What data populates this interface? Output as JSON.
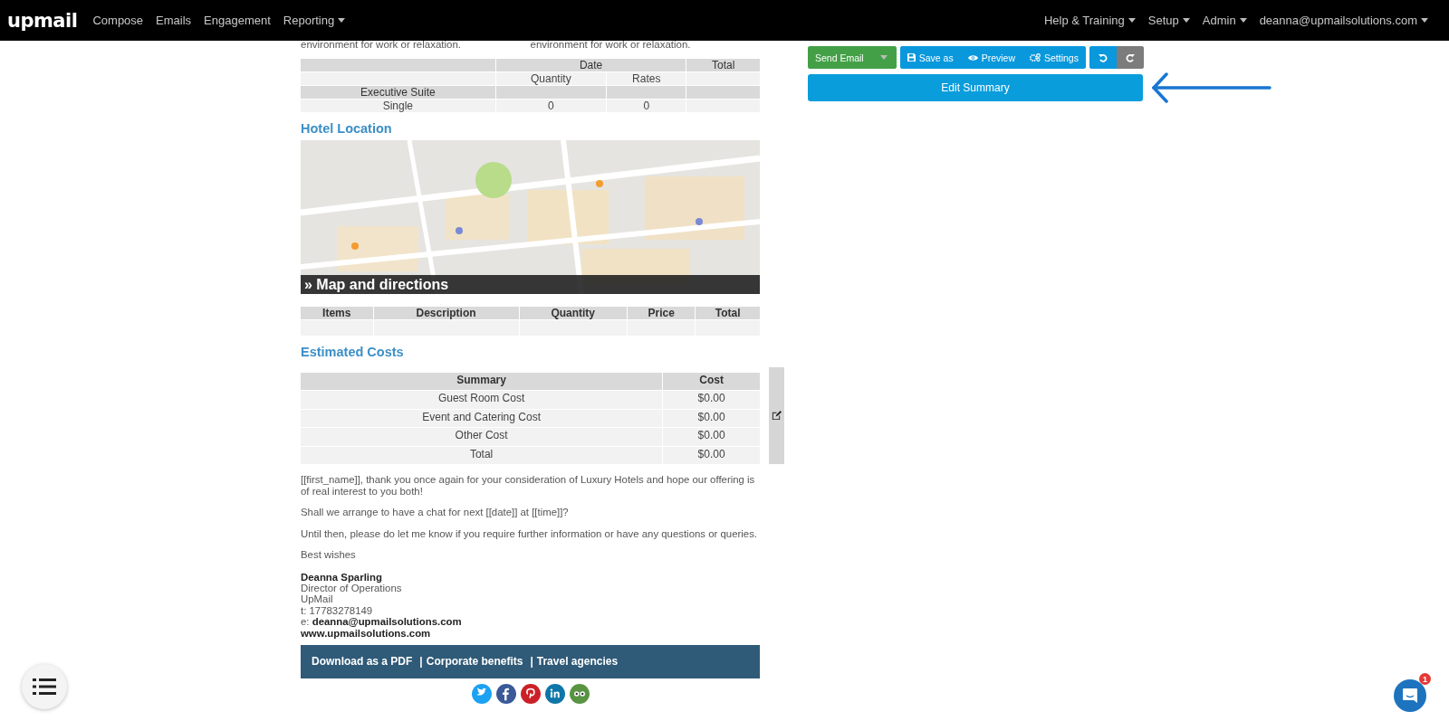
{
  "nav": {
    "logo": "upmail",
    "left": [
      {
        "label": "Compose",
        "dropdown": false
      },
      {
        "label": "Emails",
        "dropdown": false
      },
      {
        "label": "Engagement",
        "dropdown": false
      },
      {
        "label": "Reporting",
        "dropdown": true
      }
    ],
    "right": [
      {
        "label": "Help & Training",
        "dropdown": true
      },
      {
        "label": "Setup",
        "dropdown": true
      },
      {
        "label": "Admin",
        "dropdown": true
      },
      {
        "label": "deanna@upmailsolutions.com",
        "dropdown": true
      }
    ]
  },
  "email": {
    "intro_columns": [
      "environment for work or relaxation.",
      "environment for work or relaxation."
    ],
    "rates_table": {
      "header": {
        "date": "Date",
        "total": "Total"
      },
      "rows": [
        {
          "kind": "subheader",
          "quantity": "Quantity",
          "rates": "Rates"
        },
        {
          "kind": "group",
          "label": "Executive Suite"
        },
        {
          "kind": "item",
          "label": "Single",
          "quantity": "0",
          "rates": "0"
        }
      ]
    },
    "location_heading": "Hotel Location",
    "map": {
      "kind": "picture",
      "caption": "» Map and directions"
    },
    "items_table": {
      "columns": [
        "Items",
        "Description",
        "Quantity",
        "Price",
        "Total"
      ],
      "empty_rows": [
        {
          "kind": "blank"
        }
      ]
    },
    "costs_heading": "Estimated Costs",
    "costs_table": {
      "columns": [
        "Summary",
        "Cost"
      ],
      "rows": [
        [
          "Guest Room Cost",
          "$0.00"
        ],
        [
          "Event and Catering Cost",
          "$0.00"
        ],
        [
          "Other Cost",
          "$0.00"
        ],
        [
          "Total",
          "$0.00"
        ]
      ]
    },
    "paragraphs": [
      "[[first_name]], thank you once again for your consideration of Luxury Hotels and hope our offering is of real interest to you both!",
      "Shall we arrange to have a chat for next [[date]] at [[time]]?",
      "Until then, please do let me know if you require further information or have any questions or queries.",
      "Best wishes"
    ],
    "signature": {
      "name": "Deanna Sparling",
      "lines": [
        "Director of Operations",
        "UpMail",
        "t: 17783278149",
        "e: **deanna@upmailsolutions.com**"
      ],
      "website": "www.upmailsolutions.com"
    },
    "footer": {
      "links": [
        "Download as a PDF",
        "Corporate benefits",
        "Travel agencies"
      ],
      "separator": "|"
    },
    "social": [
      {
        "kind": "twitter"
      },
      {
        "kind": "facebook"
      },
      {
        "kind": "pinterest"
      },
      {
        "kind": "linkedin"
      },
      {
        "kind": "tripadvisor"
      }
    ]
  },
  "toolbar": {
    "send": "Send Email",
    "actions": [
      {
        "kind": "save",
        "label": "Save as"
      },
      {
        "kind": "preview",
        "label": "Preview"
      },
      {
        "kind": "settings",
        "label": "Settings"
      }
    ],
    "undo_disabled": false,
    "redo_disabled": true,
    "edit_summary": "Edit Summary"
  },
  "chat": {
    "badge": "1"
  }
}
